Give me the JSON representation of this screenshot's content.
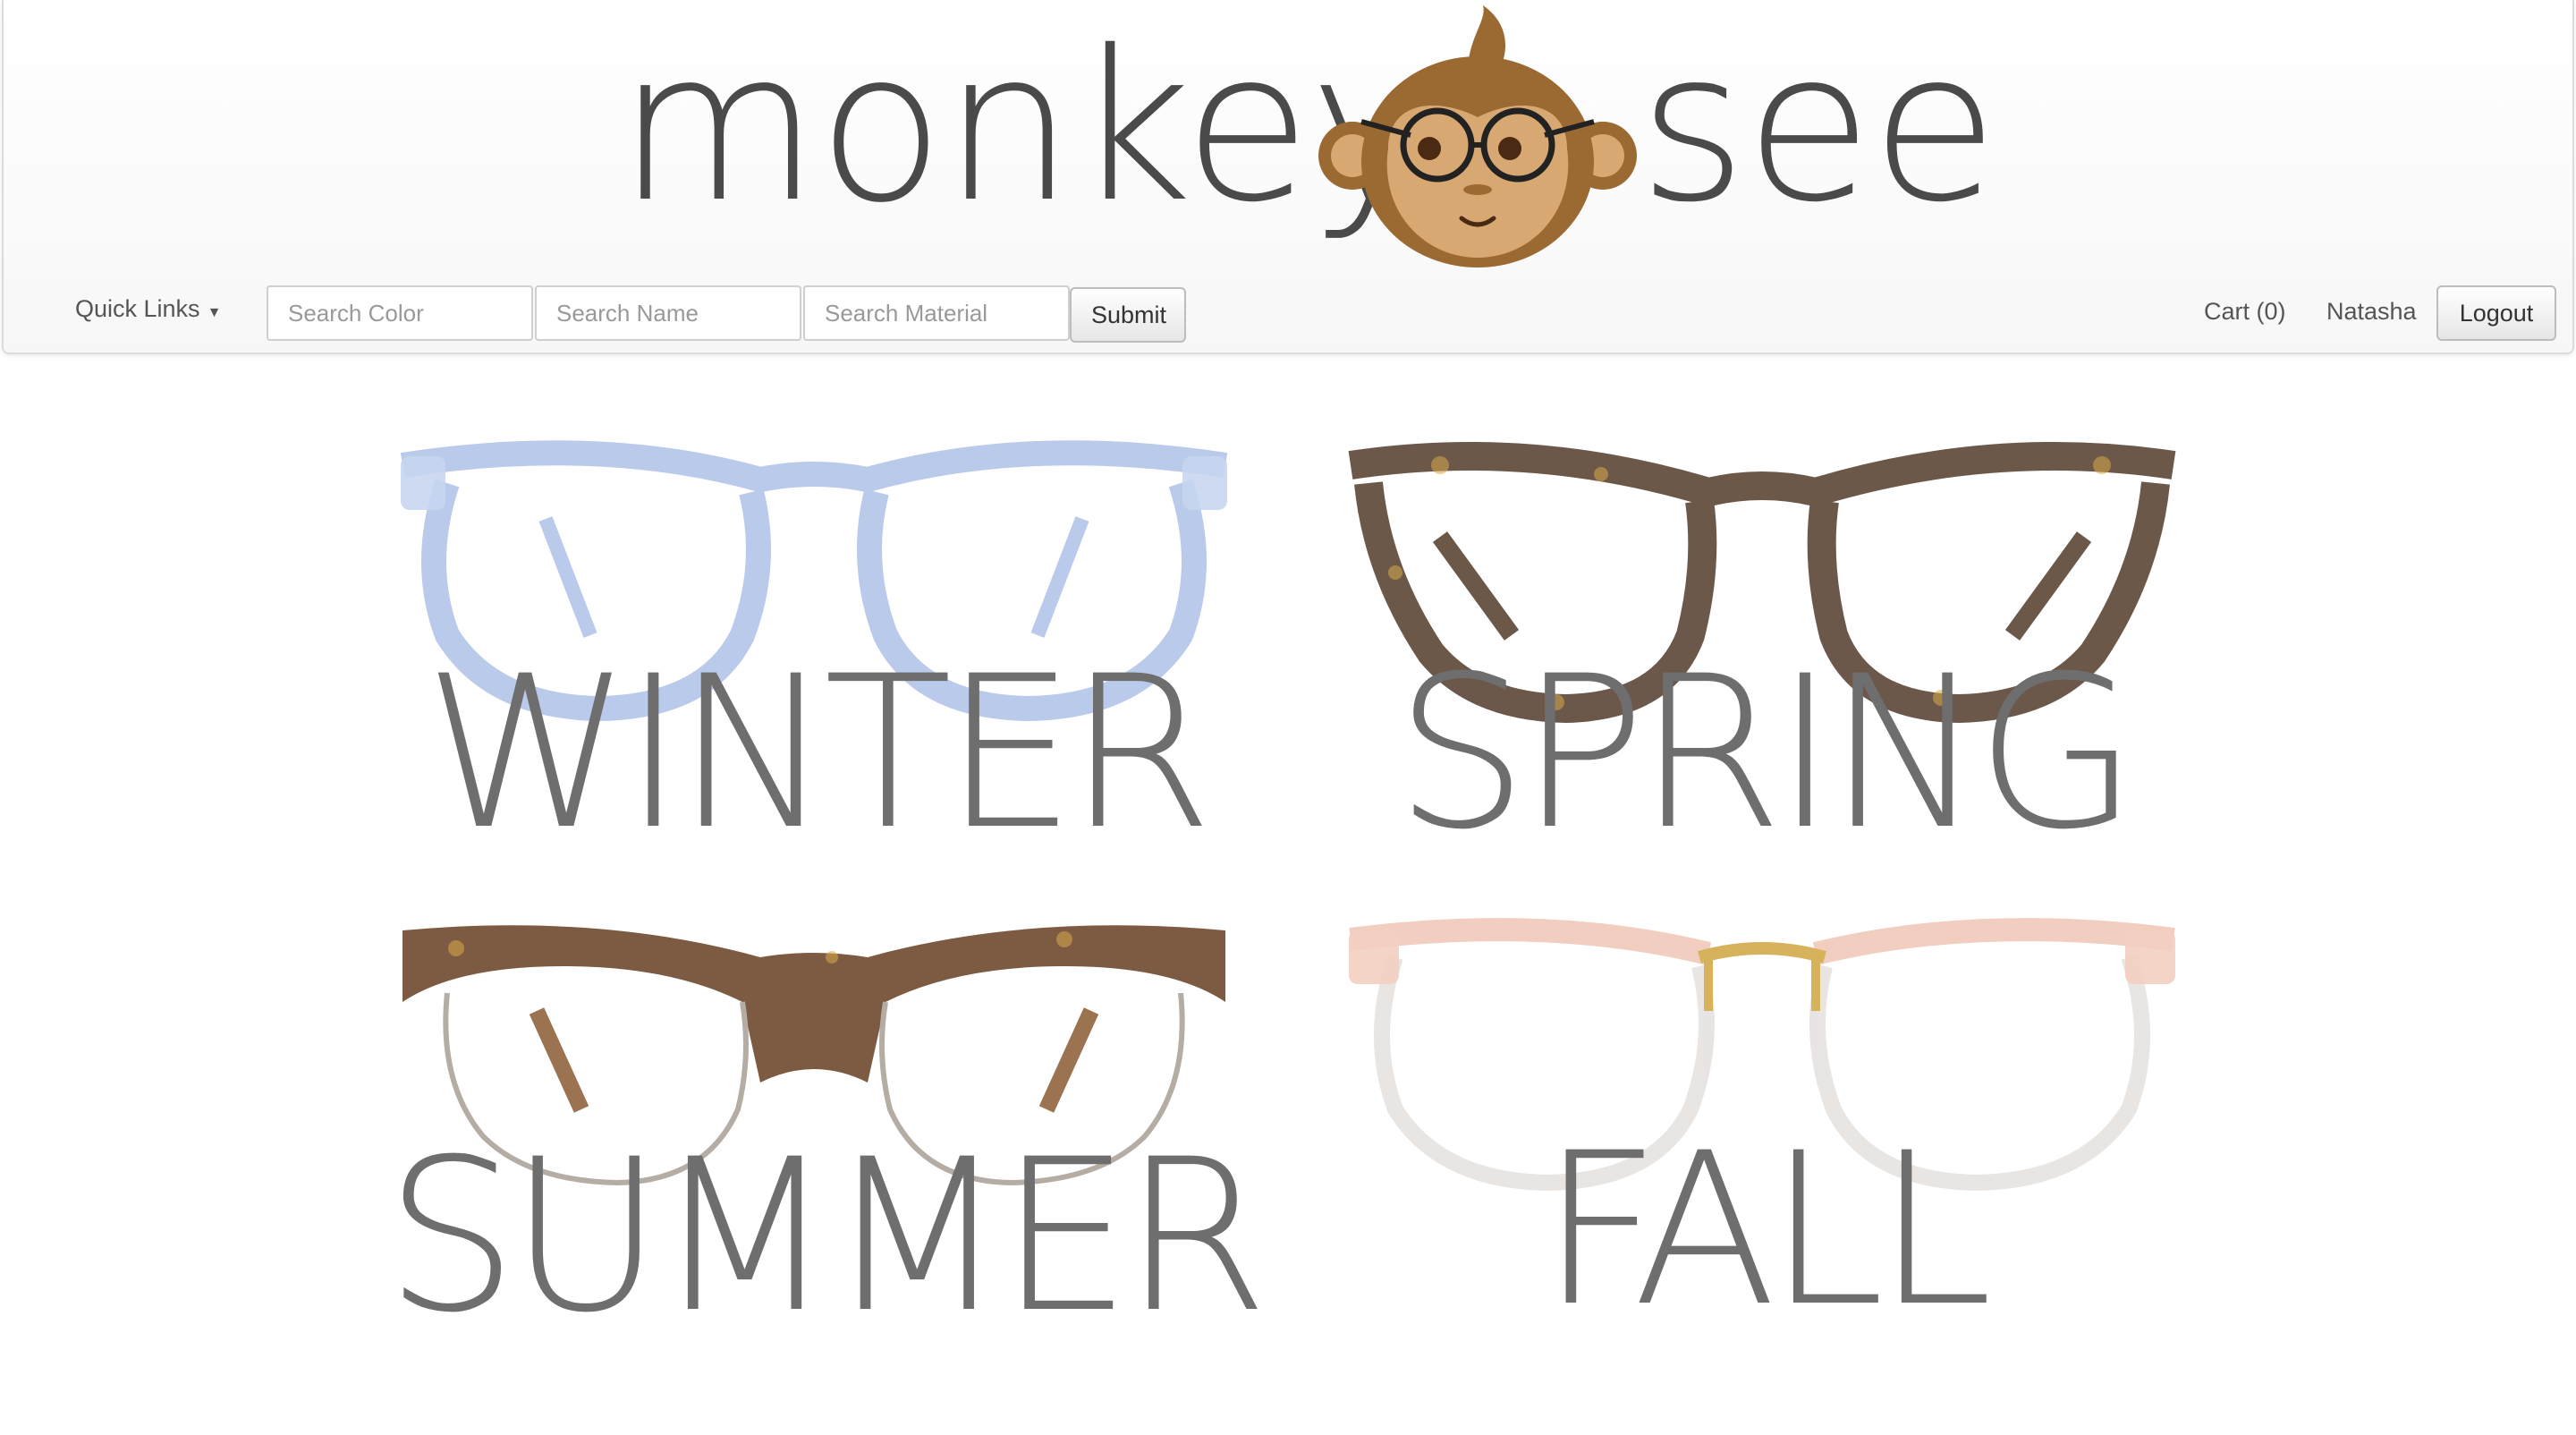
{
  "brand": {
    "word_left": "monkey",
    "word_right": "see"
  },
  "nav": {
    "quick_links": "Quick Links",
    "search_color_placeholder": "Search Color",
    "search_name_placeholder": "Search Name",
    "search_material_placeholder": "Search Material",
    "submit_label": "Submit",
    "cart_label": "Cart (0)",
    "user_name": "Natasha",
    "logout_label": "Logout"
  },
  "seasons": [
    {
      "label": "WINTER",
      "frame_color": "#a9bde6"
    },
    {
      "label": "SPRING",
      "frame_color": "#5b4636"
    },
    {
      "label": "SUMMER",
      "frame_color": "#6a4428"
    },
    {
      "label": "FALL",
      "frame_color": "#efc9b8"
    }
  ],
  "colors": {
    "text_dark": "#4a4a4a",
    "monkey_brown": "#9b6a33"
  }
}
